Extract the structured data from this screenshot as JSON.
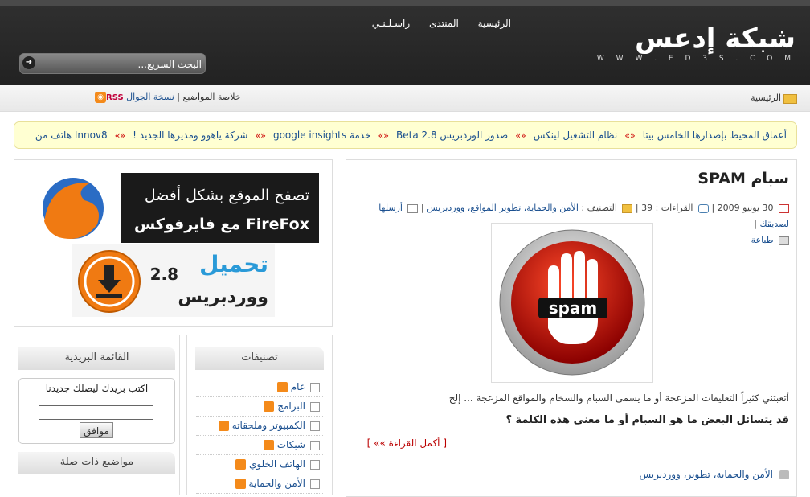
{
  "site": {
    "logo_text": "شبكة إدعس",
    "logo_url_text": "W W W . E D 3 S . C O M"
  },
  "nav": [
    "الرئيسية",
    "المنتدى",
    "راسـلـنـي"
  ],
  "search": {
    "placeholder": "البحث السريع..."
  },
  "breadcrumb": {
    "home": "الرئيسية"
  },
  "toplinks": {
    "mobile": "نسخة الجوال",
    "feed": "خلاصة المواضيع",
    "rss_label": "RSS"
  },
  "ticker": {
    "items": [
      "أعماق المحيط بإصدارها الخامس بيتا",
      "نظام التشغيل لينكس",
      "صدور الوردبريس Beta 2.8",
      "خدمة google insights",
      "شركة ياهوو ومديرها الجديد !",
      "Innov8 هاتف من"
    ],
    "separator": "«»"
  },
  "post": {
    "title": "سبام SPAM",
    "date": "30 يونيو 2009",
    "reads_label": "القراءات : 39",
    "category_label": "التصنيف :",
    "categories": "الأمن والحماية، تطوير المواقع، ووردبريس",
    "send_label": "أرسلها لصديقك",
    "print_label": "طباعة",
    "image_word": "spam",
    "excerpt": "أتعبتني كثيراً التعليقات المزعجة أو ما يسمى السبام والسخام والمواقع المزعجة ... إلخ",
    "question": "قد يتسائل البعض ما هو السبام أو ما معنى هذه الكلمة ؟",
    "read_more": "[ أكمل القراءة »» ]",
    "tags": "الأمن والحماية، تطوير، ووردبريس"
  },
  "ads": {
    "firefox_line1": "تصفح الموقع بشكل أفضل",
    "firefox_line2": "مع فايرفوكس FireFox",
    "wp_line1": "تحميل",
    "wp_version": "2.8",
    "wp_line2": "ووردبريس"
  },
  "categories_box": {
    "title": "تصنيفات",
    "items": [
      "عام",
      "البرامج",
      "الكمبيوتر وملحقاته",
      "شبكات",
      "الهاتف الخلوي",
      "الأمن والحماية"
    ]
  },
  "mailing": {
    "title": "القائمة البريدية",
    "prompt": "اكتب بريدك ليصلك جديدنا",
    "button": "موافق"
  },
  "related": {
    "title": "مواضيع ذات صلة"
  },
  "colors": {
    "link": "#1a4f8f",
    "accent_red": "#b00000",
    "feed_orange": "#f48a1a"
  }
}
